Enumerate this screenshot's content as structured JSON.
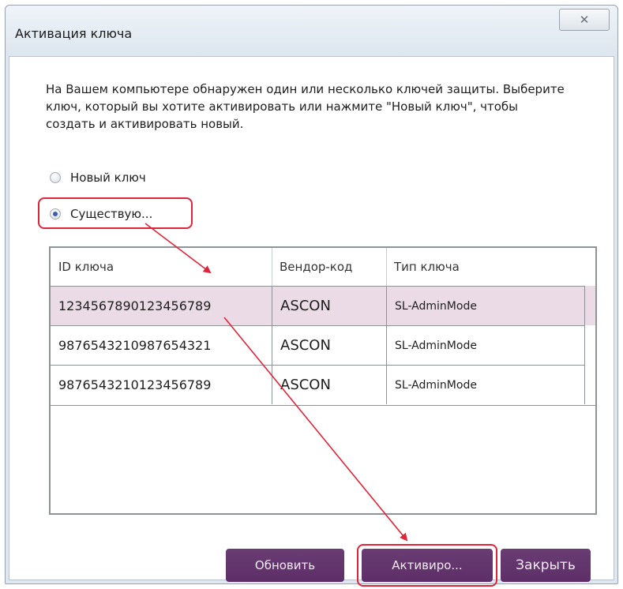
{
  "window": {
    "title": "Активация ключа",
    "close_glyph": "✕"
  },
  "description": "На Вашем компьютере обнаружен один или несколько ключей защиты. Выберите ключ, который вы хотите активировать или нажмите \"Новый ключ\", чтобы создать и активировать новый.",
  "options": {
    "new_key": {
      "label": "Новый ключ",
      "selected": false
    },
    "existing": {
      "label": "Существую...",
      "selected": true
    }
  },
  "table": {
    "columns": [
      "ID ключа",
      "Вендор-код",
      "Тип ключа"
    ],
    "rows": [
      {
        "id": "1234567890123456789",
        "vendor": "ASCON",
        "type": "SL-AdminMode",
        "selected": true
      },
      {
        "id": "9876543210987654321",
        "vendor": "ASCON",
        "type": "SL-AdminMode",
        "selected": false
      },
      {
        "id": "9876543210123456789",
        "vendor": "ASCON",
        "type": "SL-AdminMode",
        "selected": false
      }
    ]
  },
  "buttons": {
    "refresh": "Обновить",
    "activate": "Активиро...",
    "close": "Закрыть"
  },
  "colors": {
    "button": "#5d2e67",
    "selected_row": "#eadbe6",
    "annotation": "#e0243a"
  }
}
